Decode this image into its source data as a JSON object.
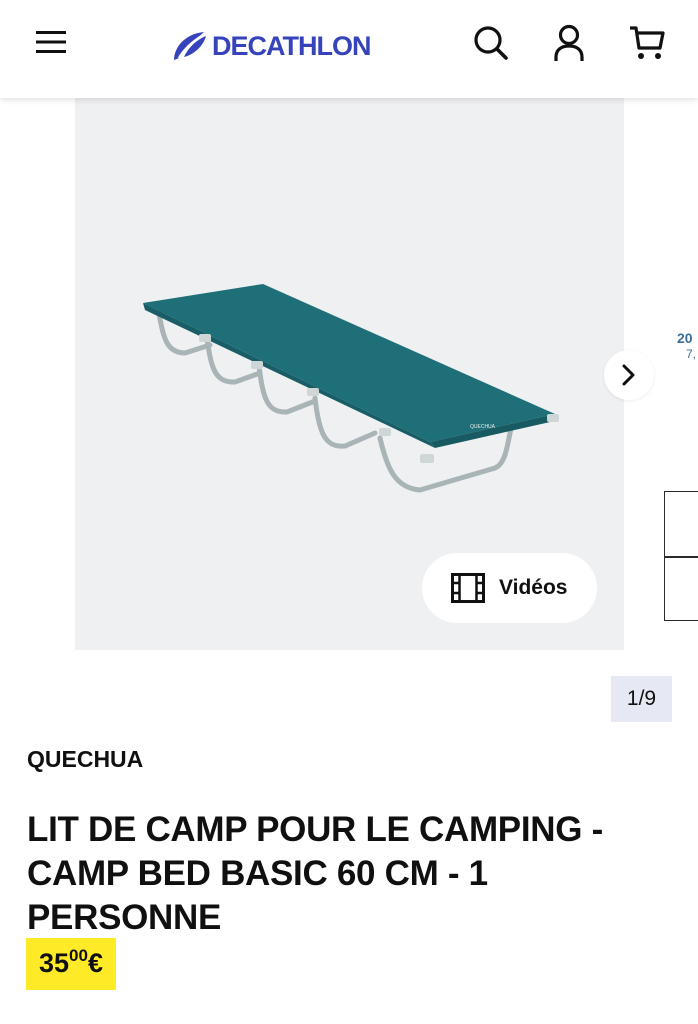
{
  "header": {
    "logo_text": "DECATHLON",
    "menu_icon": "hamburger-menu-icon",
    "search_icon": "search-icon",
    "account_icon": "user-icon",
    "cart_icon": "cart-icon"
  },
  "gallery": {
    "product_image": "camp-bed-product-image",
    "next_icon": "chevron-right-icon",
    "videos_label": "Vidéos",
    "videos_icon": "film-icon",
    "counter": "1/9",
    "peek_text_1": "20",
    "peek_text_2": "7,"
  },
  "product": {
    "brand": "QUECHUA",
    "title": "LIT DE CAMP POUR LE CAMPING - CAMP BED BASIC 60 CM - 1 PERSONNE",
    "price_integer": "35",
    "price_decimal": "00",
    "price_currency": "€"
  },
  "colors": {
    "brand_blue": "#3643ba",
    "price_highlight": "#ffea28",
    "gallery_bg": "#eff0f2",
    "counter_bg": "#e6e8f3",
    "product_fabric": "#1f6f78"
  }
}
